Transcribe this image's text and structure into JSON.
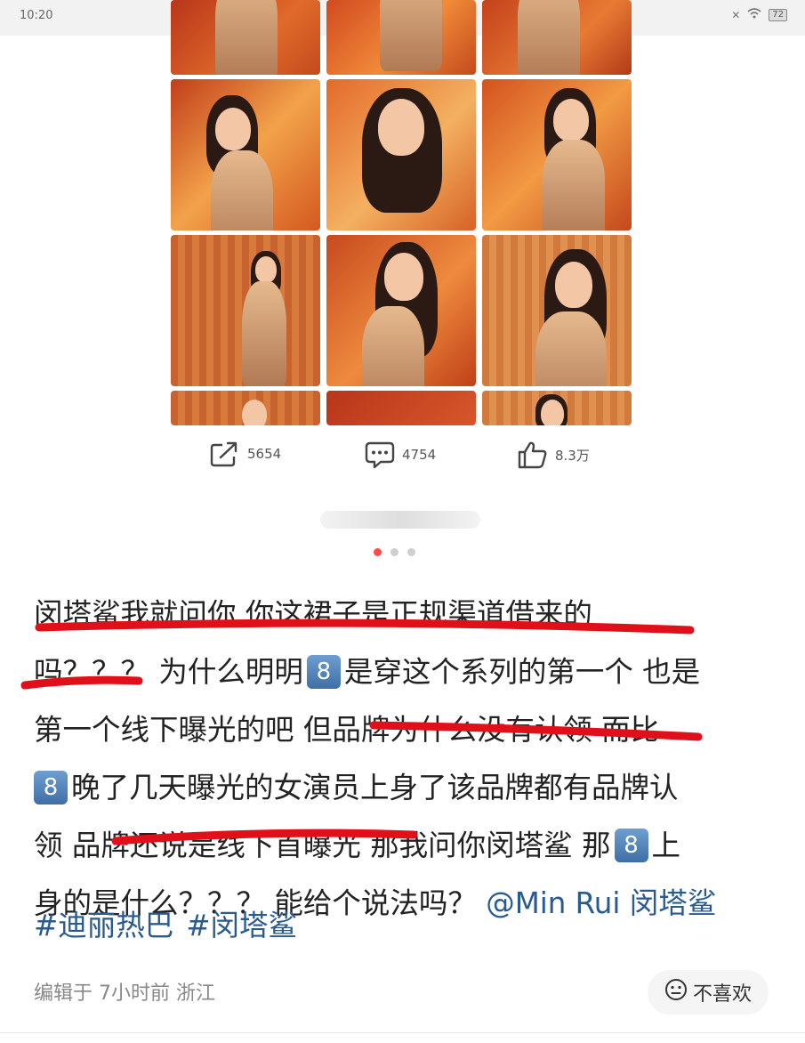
{
  "status_bar": {
    "time": "10:20",
    "dots": "•••",
    "battery": "72"
  },
  "actions": {
    "repost_count": "5654",
    "comment_count": "4754",
    "like_count": "8.3万"
  },
  "post": {
    "line1": "闵塔鲨我就问你 你这裙子是正规渠道借来的",
    "line2a": "吗？？？ 为什么明明",
    "box_char": "8",
    "line2b": "是穿这个系列的第一个 也是",
    "line3": "第一个线下曝光的吧 但品牌为什么没有认领 而比",
    "line4b": "晚了几天曝光的女演员上身了该品牌都有品牌认",
    "line5a": "领 品牌还说是线下首曝光 那我问你闵塔鲨 那",
    "line5b": "上",
    "line6a": "身的是什么？？？ 能给个说法吗？",
    "mention": "@Min Rui 闵塔鲨",
    "tags": [
      "#迪丽热巴",
      "#闵塔鲨"
    ]
  },
  "footer": {
    "meta": "编辑于 7小时前 浙江",
    "dislike_label": "不喜欢"
  },
  "colors": {
    "accent_red": "#e0101a",
    "link_blue": "#2a5b8e",
    "pager_active": "#ff4a4a"
  }
}
